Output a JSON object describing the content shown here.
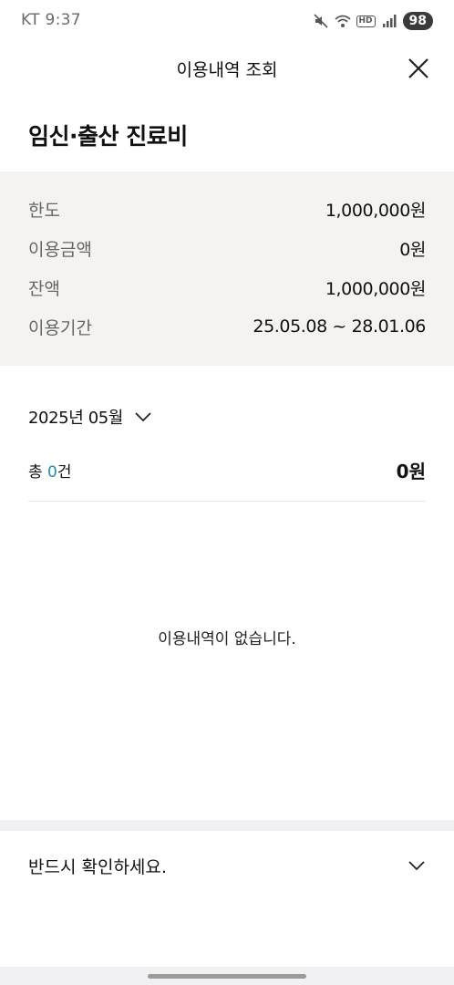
{
  "status_bar": {
    "carrier_time": "KT 9:37",
    "hd_label": "HD",
    "battery": "98"
  },
  "header": {
    "title": "이용내역 조회"
  },
  "page": {
    "title": "임신·출산 진료비"
  },
  "summary": {
    "rows": [
      {
        "label": "한도",
        "value": "1,000,000원"
      },
      {
        "label": "이용금액",
        "value": "0원"
      },
      {
        "label": "잔액",
        "value": "1,000,000원"
      },
      {
        "label": "이용기간",
        "value": "25.05.08 ~ 28.01.06"
      }
    ]
  },
  "month_selector": {
    "value": "2025년 05월"
  },
  "total": {
    "prefix": "총 ",
    "count": "0",
    "suffix": "건",
    "amount": "0원"
  },
  "empty_message": "이용내역이 없습니다.",
  "notice": {
    "title": "반드시 확인하세요."
  },
  "colors": {
    "accent_count": "#1a8fb5",
    "summary_bg": "#f4f3f1",
    "label_gray": "#666666"
  }
}
